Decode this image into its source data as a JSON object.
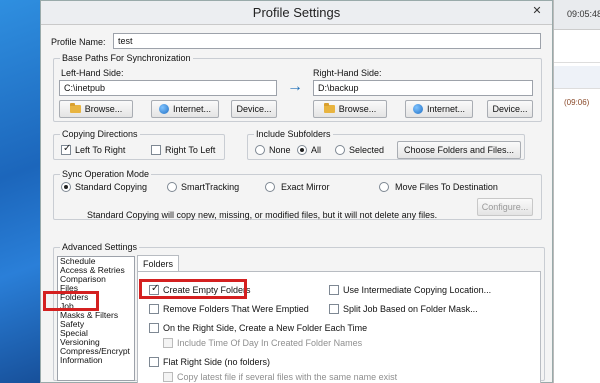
{
  "window": {
    "title": "Profile Settings",
    "close_glyph": "✕"
  },
  "right_app": {
    "time_top": "09:05:48",
    "time_mid": "(09:06)"
  },
  "profile": {
    "name_label": "Profile Name:",
    "name_value": "test"
  },
  "base_paths": {
    "title": "Base Paths For Synchronization",
    "left_label": "Left-Hand Side:",
    "left_value": "C:\\inetpub",
    "right_label": "Right-Hand Side:",
    "right_value": "D:\\backup",
    "arrow_glyph": "→",
    "browse": "Browse...",
    "internet": "Internet...",
    "device": "Device..."
  },
  "copy_dir": {
    "title": "Copying Directions",
    "left_to_right": "Left To Right",
    "right_to_left": "Right To Left"
  },
  "subfolders": {
    "title": "Include Subfolders",
    "none": "None",
    "all": "All",
    "selected": "Selected",
    "choose": "Choose Folders and Files..."
  },
  "sync_mode": {
    "title": "Sync Operation Mode",
    "standard": "Standard Copying",
    "smart": "SmartTracking",
    "mirror": "Exact Mirror",
    "move": "Move Files To Destination",
    "description": "Standard Copying will copy new, missing, or modified files, but it will not delete any files.",
    "configure": "Configure..."
  },
  "advanced": {
    "title": "Advanced Settings",
    "items": [
      "Schedule",
      "Access & Retries",
      "Comparison",
      "Files",
      "Folders",
      "Job",
      "Masks & Filters",
      "Safety",
      "Special",
      "Versioning",
      "Compress/Encrypt",
      "Information"
    ],
    "tab": "Folders",
    "options": {
      "create_empty": "Create Empty Folders",
      "intermediate": "Use Intermediate Copying Location...",
      "remove_empty": "Remove Folders That Were Emptied",
      "split_job": "Split Job Based on Folder Mask...",
      "new_folder": "On the Right Side, Create a New Folder Each Time",
      "include_time": "Include Time Of Day In Created Folder Names",
      "flat_right": "Flat Right Side (no folders)",
      "copy_latest": "Copy latest file if several files with the same name exist"
    }
  },
  "accent": {
    "highlight": "#d42020"
  }
}
